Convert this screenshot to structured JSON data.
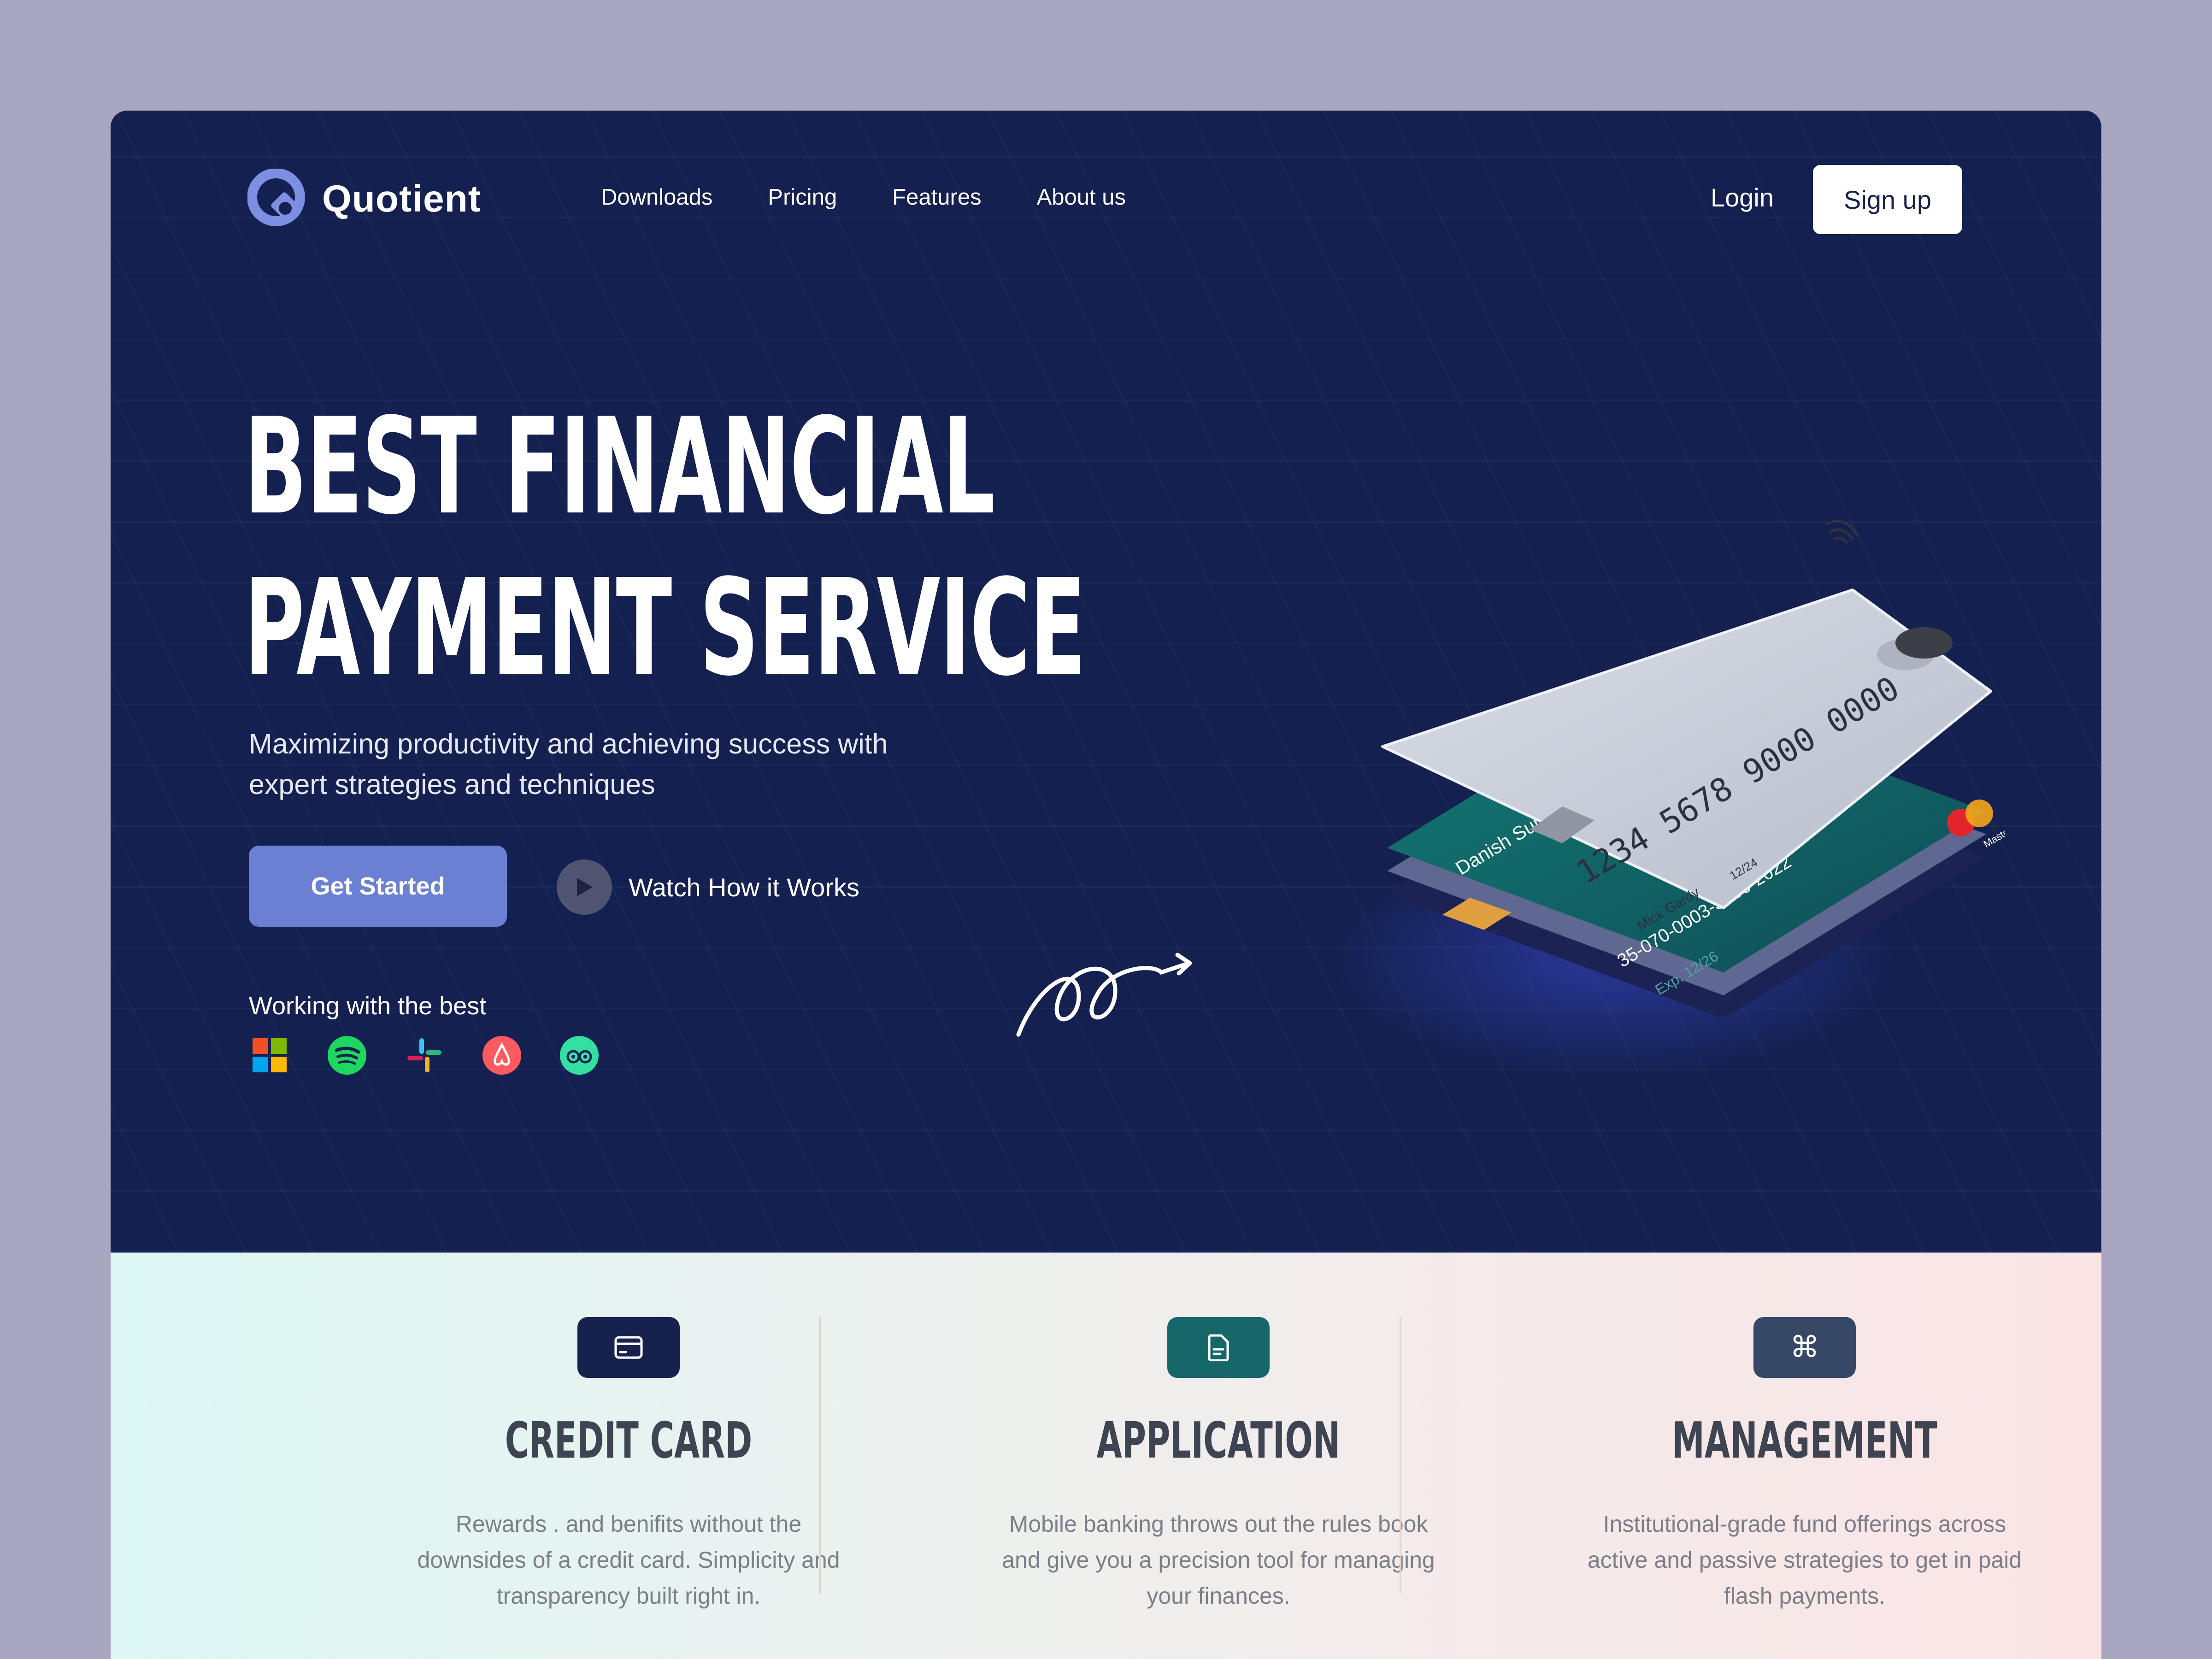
{
  "brand": {
    "name": "Quotient"
  },
  "nav": {
    "items": [
      "Downloads",
      "Pricing",
      "Features",
      "About us"
    ],
    "login": "Login",
    "signup": "Sign up"
  },
  "hero": {
    "headline_line1": "BEST FINANCIAL",
    "headline_line2": "PAYMENT SERVICE",
    "subtitle": "Maximizing productivity and achieving success with expert strategies and techniques",
    "cta_primary": "Get Started",
    "cta_secondary": "Watch How it Works",
    "partners_label": "Working with the best",
    "partners": [
      "microsoft-icon",
      "spotify-icon",
      "slack-icon",
      "airbnb-icon",
      "tripadvisor-icon"
    ]
  },
  "cards": {
    "front": {
      "number": "1234 5678 9000 0000",
      "holder": "Mick Gardy",
      "expiry": "12/24"
    },
    "back": {
      "holder": "Danish Sury",
      "number": "35-070-0003-3256-2022",
      "expiry": "Exp. 12/26",
      "brand": "Mastercard"
    }
  },
  "features": [
    {
      "icon": "credit-card-icon",
      "color": "#16214d",
      "title": "CREDIT CARD",
      "desc": "Rewards . and benifits without the downsides of a credit card. Simplicity and transparency built right in."
    },
    {
      "icon": "document-icon",
      "color": "#15676a",
      "title": "APPLICATION",
      "desc": "Mobile banking throws out the rules book and give you a precision tool for managing your finances."
    },
    {
      "icon": "command-icon",
      "color": "#374766",
      "title": "MANAGEMENT",
      "desc": "Institutional-grade fund offerings across active and passive strategies to get in paid flash payments."
    }
  ],
  "colors": {
    "navy": "#14204f",
    "accent": "#6b80d2",
    "backdrop": "#a9a6c1"
  }
}
